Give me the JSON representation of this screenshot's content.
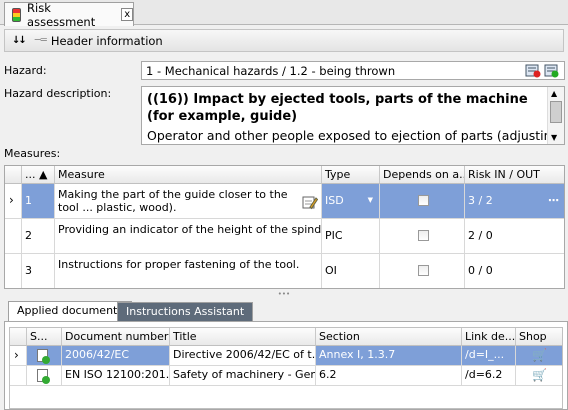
{
  "tab": {
    "title": "Risk assessment",
    "close": "x"
  },
  "header": {
    "title": "Header information"
  },
  "hazard": {
    "label": "Hazard:",
    "value": "1 - Mechanical hazards / 1.2 - being thrown"
  },
  "hazard_description": {
    "label": "Hazard description:",
    "title": "((16)) Impact by ejected tools, parts of the machine (for example, guide)",
    "body": "Operator and other people exposed to ejection of parts (adjusting the"
  },
  "measures": {
    "label": "Measures:",
    "columns": [
      "... ▲",
      "Measure",
      "Type",
      "Depends on a...",
      "Risk IN / OUT"
    ],
    "rows": [
      {
        "num": "1",
        "measure": "Making the part of the guide closer to the tool ... plastic, wood).",
        "type": "ISD",
        "risk": "3 / 2",
        "selected": true
      },
      {
        "num": "2",
        "measure": "Providing an indicator of the height of the spindle n...",
        "type": "PIC",
        "risk": "2 / 0",
        "selected": false
      },
      {
        "num": "3",
        "measure": "Instructions for proper fastening of the tool.",
        "type": "OI",
        "risk": "0 / 0",
        "selected": false
      }
    ]
  },
  "bottom_tabs": [
    "Applied documents",
    "Instructions Assistant"
  ],
  "documents": {
    "columns": [
      "S...",
      "Document number",
      "Title",
      "Section",
      "Link de...",
      "Shop"
    ],
    "rows": [
      {
        "number": "2006/42/EC",
        "title": "Directive 2006/42/EC of t...",
        "section": "Annex I, 1.3.7",
        "link": "/d=I_...",
        "selected": true
      },
      {
        "number": "EN ISO 12100:201...",
        "title": "Safety of machinery - Gen...",
        "section": "6.2",
        "link": "/d=6.2",
        "selected": false
      }
    ]
  }
}
